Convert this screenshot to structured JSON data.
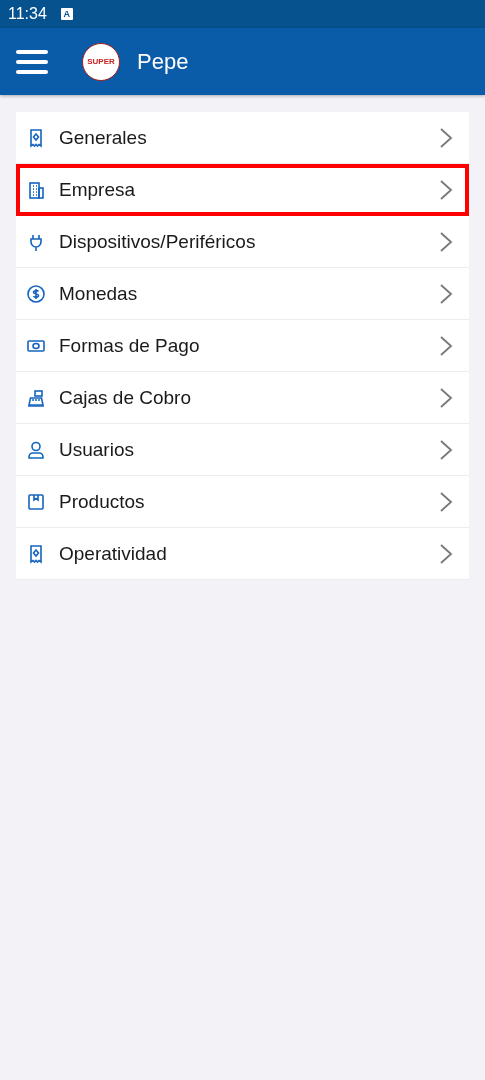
{
  "status_bar": {
    "time": "11:34",
    "notification_glyph": "A"
  },
  "app_bar": {
    "logo": {
      "text": "SUPER"
    },
    "title": "Pepe"
  },
  "menu": [
    {
      "label": "Generales",
      "kind": "receipt",
      "selected": false
    },
    {
      "label": "Empresa",
      "kind": "building",
      "selected": true
    },
    {
      "label": "Dispositivos/Periféricos",
      "kind": "plug",
      "selected": false
    },
    {
      "label": "Monedas",
      "kind": "coin",
      "selected": false
    },
    {
      "label": "Formas de Pago",
      "kind": "cash",
      "selected": false
    },
    {
      "label": "Cajas de Cobro",
      "kind": "register",
      "selected": false
    },
    {
      "label": "Usuarios",
      "kind": "user",
      "selected": false
    },
    {
      "label": "Productos",
      "kind": "box",
      "selected": false
    },
    {
      "label": "Operatividad",
      "kind": "receipt",
      "selected": false
    }
  ]
}
